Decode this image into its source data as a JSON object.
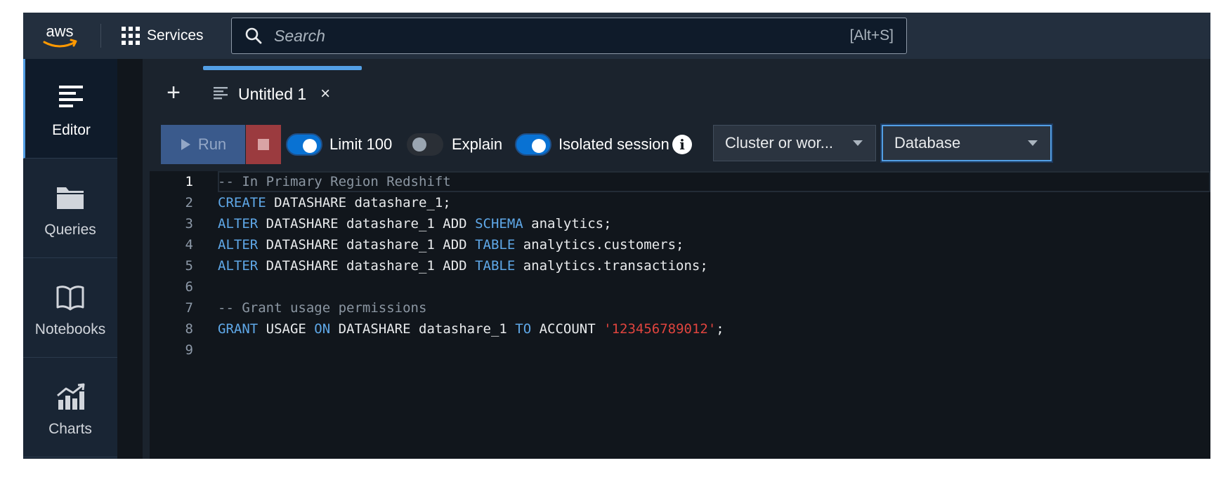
{
  "topnav": {
    "logo_text": "aws",
    "services_label": "Services",
    "search_placeholder": "Search",
    "search_value": "",
    "search_shortcut": "[Alt+S]"
  },
  "sidebar": {
    "items": [
      {
        "label": "Editor",
        "icon": "editor-icon",
        "active": true
      },
      {
        "label": "Queries",
        "icon": "folder-icon",
        "active": false
      },
      {
        "label": "Notebooks",
        "icon": "book-icon",
        "active": false
      },
      {
        "label": "Charts",
        "icon": "chart-icon",
        "active": false
      }
    ]
  },
  "tabs": {
    "add_label": "+",
    "items": [
      {
        "label": "Untitled 1",
        "close": "×"
      }
    ]
  },
  "toolbar": {
    "run_label": "Run",
    "limit_label": "Limit 100",
    "limit_on": true,
    "explain_label": "Explain",
    "explain_on": false,
    "isolated_label": "Isolated session",
    "isolated_on": true,
    "info_glyph": "i",
    "cluster_value": "Cluster or wor...",
    "database_value": "Database"
  },
  "editor": {
    "active_line": 1,
    "lines": [
      {
        "num": "1",
        "tokens": [
          {
            "t": "-- In Primary Region Redshift",
            "c": "cm"
          }
        ]
      },
      {
        "num": "2",
        "tokens": [
          {
            "t": "CREATE",
            "c": "kw"
          },
          {
            "t": " DATASHARE datashare_1;",
            "c": ""
          }
        ]
      },
      {
        "num": "3",
        "tokens": [
          {
            "t": "ALTER",
            "c": "kw"
          },
          {
            "t": " DATASHARE datashare_1 ADD ",
            "c": ""
          },
          {
            "t": "SCHEMA",
            "c": "kw"
          },
          {
            "t": " analytics;",
            "c": ""
          }
        ]
      },
      {
        "num": "4",
        "tokens": [
          {
            "t": "ALTER",
            "c": "kw"
          },
          {
            "t": " DATASHARE datashare_1 ADD ",
            "c": ""
          },
          {
            "t": "TABLE",
            "c": "kw"
          },
          {
            "t": " analytics.customers;",
            "c": ""
          }
        ]
      },
      {
        "num": "5",
        "tokens": [
          {
            "t": "ALTER",
            "c": "kw"
          },
          {
            "t": " DATASHARE datashare_1 ADD ",
            "c": ""
          },
          {
            "t": "TABLE",
            "c": "kw"
          },
          {
            "t": " analytics.transactions;",
            "c": ""
          }
        ]
      },
      {
        "num": "6",
        "tokens": []
      },
      {
        "num": "7",
        "tokens": [
          {
            "t": "-- Grant usage permissions",
            "c": "cm"
          }
        ]
      },
      {
        "num": "8",
        "tokens": [
          {
            "t": "GRANT",
            "c": "kw"
          },
          {
            "t": " USAGE ",
            "c": ""
          },
          {
            "t": "ON",
            "c": "kw"
          },
          {
            "t": " DATASHARE datashare_1 ",
            "c": ""
          },
          {
            "t": "TO",
            "c": "kw"
          },
          {
            "t": " ACCOUNT ",
            "c": ""
          },
          {
            "t": "'123456789012'",
            "c": "st"
          },
          {
            "t": ";",
            "c": ""
          }
        ]
      },
      {
        "num": "9",
        "tokens": []
      }
    ]
  },
  "colors": {
    "accent": "#539fe5",
    "toggle_on": "#0972d3",
    "keyword": "#5fa8e8",
    "comment": "#8b96a2",
    "string": "#e0443e",
    "aws_orange": "#ff9900"
  }
}
